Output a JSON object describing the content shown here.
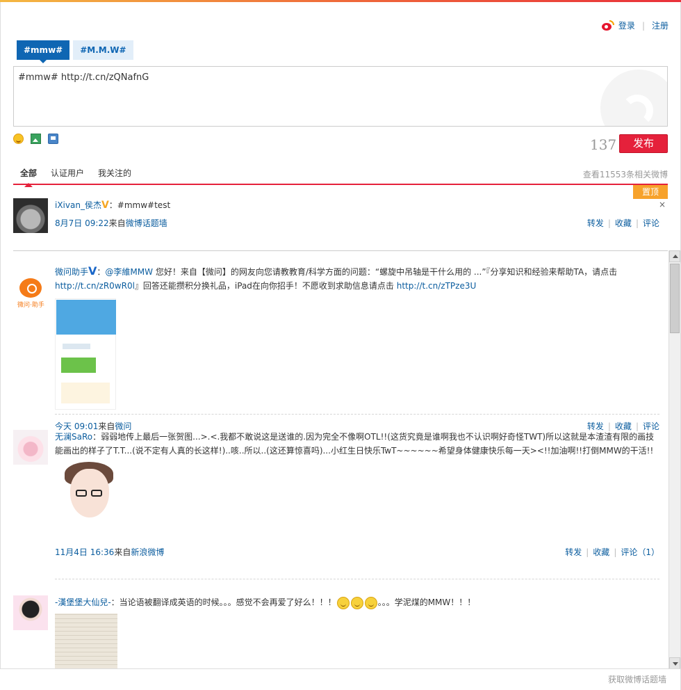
{
  "header": {
    "login_label": "登录",
    "register_label": "注册"
  },
  "tabs": [
    {
      "label": "#mmw#"
    },
    {
      "label": "#M.M.W#"
    }
  ],
  "composer": {
    "value": "#mmw# http://t.cn/zQNafnG",
    "char_count": "137",
    "publish_label": "发布"
  },
  "filters": {
    "items": [
      "全部",
      "认证用户",
      "我关注的"
    ],
    "total": "查看11553条相关微博"
  },
  "pinned_label": "置顶",
  "close_label": "×",
  "posts": [
    {
      "author": "iXivan_侯杰",
      "badge": "V",
      "text": "：#mmw#test",
      "time": "8月7日  09:22",
      "from_prefix": "来自",
      "source": "微博话题墙",
      "repost": "转发",
      "fav": "收藏",
      "comment": "评论"
    },
    {
      "author": "微问助手",
      "badge": "V",
      "avatar_label": "微问·助手",
      "text_pre": "：",
      "mention": "@李維MMW",
      "text_mid": " 您好！来自【微问】的网友向您请教教育/科学方面的问题：“螺旋中吊轴是干什么用的 ...”『分享知识和经验来帮助TA，请点击",
      "link1": "http://t.cn/zR0wR0l",
      "text_mid2": "』回答还能攒积分换礼品，iPad在向你招手！不愿收到求助信息请点击 ",
      "link2": "http://t.cn/zTPze3U",
      "time": "今天  09:01",
      "from_prefix": "来自",
      "source": "微问",
      "repost": "转发",
      "fav": "收藏",
      "comment": "评论"
    },
    {
      "author": "无澜SaRo",
      "text": "：弱弱地传上最后一张贺图...>.<.我都不敢说这是送谁的.因为完全不像啊OTL!!(这货究竟是谁啊我也不认识啊好奇怪TWT)所以这就是本渣渣有限的画技能画出的样子了T.T...(说不定有人真的长这样!)..咳..所以..(这还算惊喜吗)...小红生日快乐TwT~~~~~~希望身体健康快乐每一天><!!加油啊!!打倒MMW的干活!!",
      "time": "11月4日  16:36",
      "from_prefix": "来自",
      "source": "新浪微博",
      "repost": "转发",
      "fav": "收藏",
      "comment": "评论（1）"
    },
    {
      "author": "-漢堡堡大仙兒-",
      "text_pre": "：当论语被翻译成英语的时候。。。感觉不会再爱了好么！！！",
      "text_post": "。。。学泥煤的MMW！！！"
    }
  ],
  "footer": {
    "label": "获取微博话题墙"
  },
  "colors": {
    "accent_red": "#e5213b",
    "link_blue": "#0a5c9e",
    "tab_blue": "#0f66b3",
    "pin_orange": "#f7a22b"
  }
}
